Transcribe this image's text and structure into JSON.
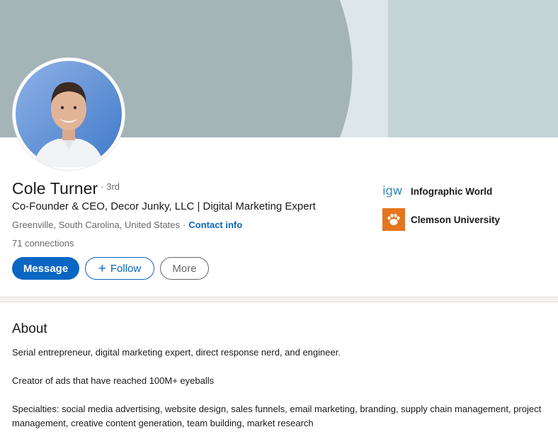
{
  "profile": {
    "name": "Cole Turner",
    "degree": "· 3rd",
    "headline": "Co-Founder & CEO, Decor Junky, LLC | Digital Marketing Expert",
    "location": "Greenville, South Carolina, United States",
    "separator": "·",
    "contact_label": "Contact info",
    "connections": "71 connections"
  },
  "actions": {
    "message_label": "Message",
    "follow_label": "Follow",
    "more_label": "More"
  },
  "orgs": [
    {
      "name": "Infographic World",
      "logo_text": "igw",
      "icon": "igw-logo-icon"
    },
    {
      "name": "Clemson University",
      "icon": "tiger-paw-icon"
    }
  ],
  "about": {
    "title": "About",
    "para1": "Serial entrepreneur, digital marketing expert, direct response nerd, and engineer.",
    "para2": "Creator of ads that have reached 100M+ eyeballs",
    "para3": "Specialties: social media advertising, website design, sales funnels, email marketing, branding, supply chain management, project management, creative content generation, team building, market research"
  },
  "colors": {
    "accent": "#0a66c2",
    "banner_main": "#a4b4b7",
    "banner_light": "#c3d3d6",
    "clemson_orange": "#e4761f"
  }
}
